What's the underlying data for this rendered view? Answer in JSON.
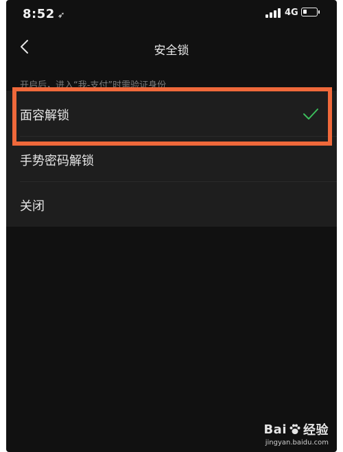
{
  "status_bar": {
    "time": "8:52",
    "network": "4G",
    "battery_level": 0.3,
    "icons": [
      "location-arrow-icon",
      "signal-icon",
      "battery-icon"
    ]
  },
  "nav": {
    "title": "安全锁",
    "back_icon": "chevron-left-icon"
  },
  "hint": "开启后，进入“我-支付”时需验证身份",
  "options": [
    {
      "label": "面容解锁",
      "selected": true
    },
    {
      "label": "手势密码解锁",
      "selected": false
    },
    {
      "label": "关闭",
      "selected": false
    }
  ],
  "colors": {
    "background": "#111111",
    "list_background": "#1e1e1e",
    "check": "#3cbf5c",
    "highlight": "#f0693b"
  },
  "watermark": {
    "logo": "Bai 经验",
    "url": "jingyan.baidu.com"
  }
}
